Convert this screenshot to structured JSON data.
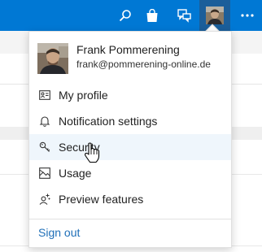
{
  "user": {
    "name": "Frank Pommerening",
    "email": "frank@pommerening-online.de"
  },
  "menu": {
    "items": [
      {
        "label": "My profile",
        "icon": "contact-card-icon"
      },
      {
        "label": "Notification settings",
        "icon": "bell-icon"
      },
      {
        "label": "Security",
        "icon": "key-icon",
        "state": "hovered"
      },
      {
        "label": "Usage",
        "icon": "image-icon"
      },
      {
        "label": "Preview features",
        "icon": "sparkle-user-icon"
      }
    ],
    "sign_out": "Sign out"
  },
  "topbar_icons": [
    "search-icon",
    "shopping-bag-icon",
    "feedback-icon",
    "avatar",
    "more-icon"
  ],
  "colors": {
    "topbar": "#0078d4",
    "hover": "#eff6fc",
    "link": "#1f6fb8"
  }
}
